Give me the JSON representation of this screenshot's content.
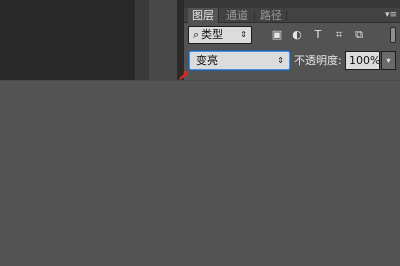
{
  "tabs": [
    {
      "label": "图层",
      "active": true
    },
    {
      "label": "通道",
      "active": false
    },
    {
      "label": "路径",
      "active": false
    }
  ],
  "panel_menu": "▾≡",
  "filter": {
    "search_glyph": "⌕",
    "selected": "类型",
    "arrow": "⇕",
    "icons": [
      {
        "name": "image-filter-icon",
        "glyph": "▣"
      },
      {
        "name": "adjustment-filter-icon",
        "glyph": "◐"
      },
      {
        "name": "text-filter-icon",
        "glyph": "T"
      },
      {
        "name": "shape-filter-icon",
        "glyph": "⌗"
      },
      {
        "name": "smart-object-filter-icon",
        "glyph": "⧉"
      }
    ]
  },
  "blend_mode": {
    "value": "变亮",
    "arrow": "⇕"
  },
  "opacity": {
    "label": "不透明度:",
    "value": "100%",
    "drop_glyph": "▾"
  },
  "colors": {
    "accent": "#4b8ed6",
    "arrow": "#d42a2a"
  }
}
